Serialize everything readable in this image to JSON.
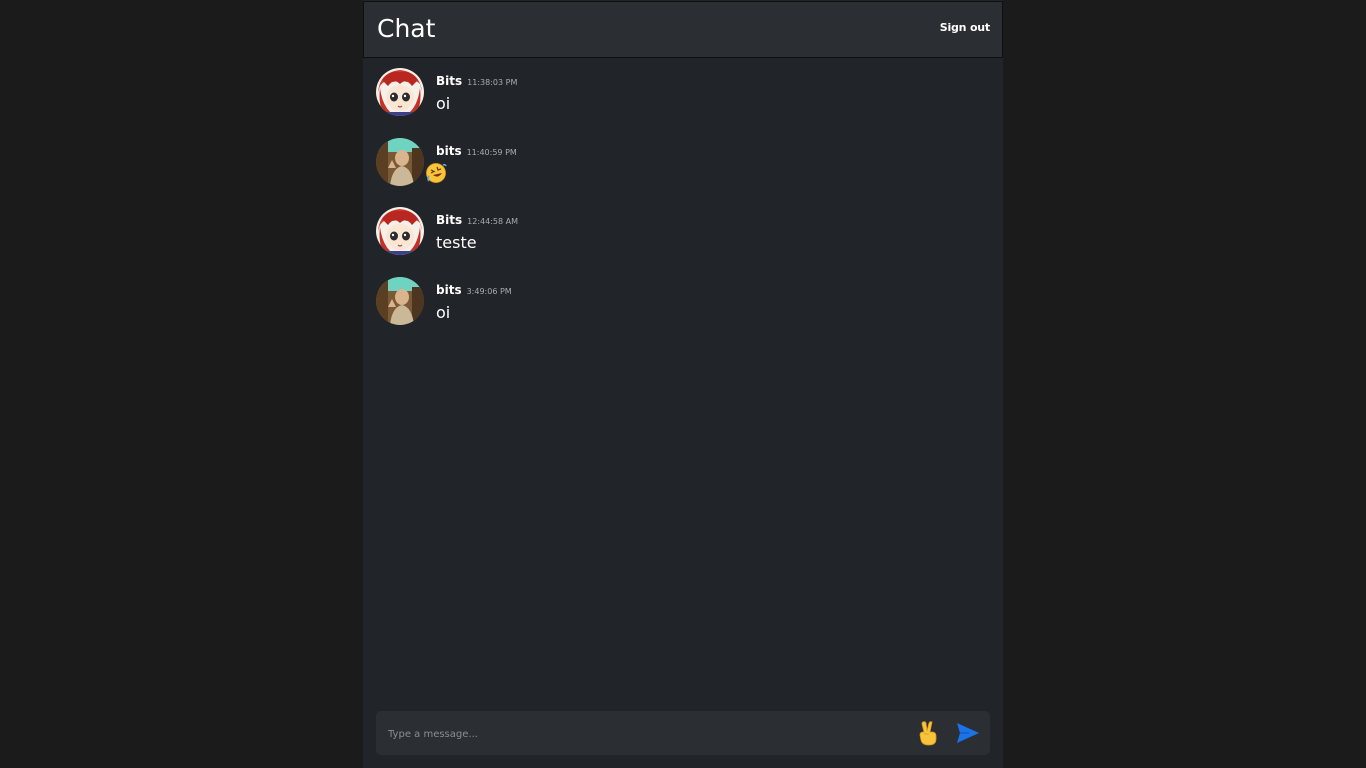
{
  "header": {
    "title": "Chat",
    "sign_out_label": "Sign out"
  },
  "messages": [
    {
      "username": "Bits",
      "time": "11:38:03 PM",
      "text": "oi",
      "avatar": "anime-avatar"
    },
    {
      "username": "bits",
      "time": "11:40:59 PM",
      "text": "",
      "emoji": "rolling-laughing-emoji",
      "avatar": "photo-avatar"
    },
    {
      "username": "Bits",
      "time": "12:44:58 AM",
      "text": "teste",
      "avatar": "anime-avatar"
    },
    {
      "username": "bits",
      "time": "3:49:06 PM",
      "text": "oi",
      "avatar": "photo-avatar"
    }
  ],
  "composer": {
    "placeholder": "Type a message...",
    "emoji_icon": "victory-hand-icon",
    "send_icon": "send-icon"
  },
  "colors": {
    "page_background": "#1b1b1b",
    "chat_background": "#212428",
    "header_background": "#2b2e33",
    "send_accent": "#1a73e8",
    "emoji_yellow": "#f7c43a"
  }
}
